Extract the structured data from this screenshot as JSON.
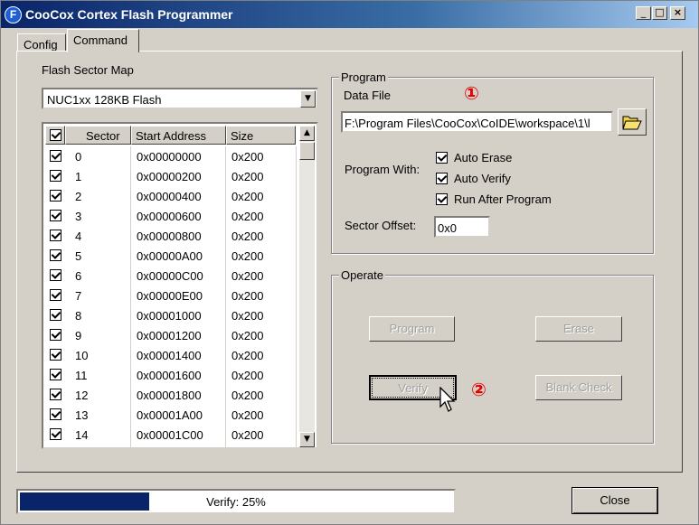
{
  "window": {
    "title": "CooCox Cortex Flash Programmer",
    "app_icon": "F"
  },
  "titlebar_buttons": {
    "minimize": "_",
    "maximize": "□",
    "close": "×"
  },
  "tabs": [
    {
      "label": "Config",
      "active": false
    },
    {
      "label": "Command",
      "active": true
    }
  ],
  "flash_sector_map": {
    "label": "Flash Sector Map",
    "selected": "NUC1xx 128KB Flash"
  },
  "sector_table": {
    "columns": [
      "Sector",
      "Start Address",
      "Size"
    ],
    "header_checked": true,
    "rows": [
      {
        "sector": "0",
        "start": "0x00000000",
        "size": "0x200",
        "checked": true
      },
      {
        "sector": "1",
        "start": "0x00000200",
        "size": "0x200",
        "checked": true
      },
      {
        "sector": "2",
        "start": "0x00000400",
        "size": "0x200",
        "checked": true
      },
      {
        "sector": "3",
        "start": "0x00000600",
        "size": "0x200",
        "checked": true
      },
      {
        "sector": "4",
        "start": "0x00000800",
        "size": "0x200",
        "checked": true
      },
      {
        "sector": "5",
        "start": "0x00000A00",
        "size": "0x200",
        "checked": true
      },
      {
        "sector": "6",
        "start": "0x00000C00",
        "size": "0x200",
        "checked": true
      },
      {
        "sector": "7",
        "start": "0x00000E00",
        "size": "0x200",
        "checked": true
      },
      {
        "sector": "8",
        "start": "0x00001000",
        "size": "0x200",
        "checked": true
      },
      {
        "sector": "9",
        "start": "0x00001200",
        "size": "0x200",
        "checked": true
      },
      {
        "sector": "10",
        "start": "0x00001400",
        "size": "0x200",
        "checked": true
      },
      {
        "sector": "11",
        "start": "0x00001600",
        "size": "0x200",
        "checked": true
      },
      {
        "sector": "12",
        "start": "0x00001800",
        "size": "0x200",
        "checked": true
      },
      {
        "sector": "13",
        "start": "0x00001A00",
        "size": "0x200",
        "checked": true
      },
      {
        "sector": "14",
        "start": "0x00001C00",
        "size": "0x200",
        "checked": true
      }
    ]
  },
  "program": {
    "group_label": "Program",
    "data_file_label": "Data File",
    "data_file_value": "F:\\Program Files\\CooCox\\CoIDE\\workspace\\1\\l",
    "program_with_label": "Program With:",
    "options": [
      {
        "label": "Auto Erase",
        "checked": true
      },
      {
        "label": "Auto Verify",
        "checked": true
      },
      {
        "label": "Run After Program",
        "checked": true
      }
    ],
    "sector_offset_label": "Sector Offset:",
    "sector_offset_value": "0x0"
  },
  "operate": {
    "group_label": "Operate",
    "buttons": {
      "program": "Program",
      "erase": "Erase",
      "verify": "Verify",
      "blank_check": "Blank Check"
    }
  },
  "annotations": {
    "marker_1": "①",
    "marker_2": "②",
    "color": "#e00000"
  },
  "progress": {
    "text": "Verify: 25%",
    "value": 0.25,
    "color": "#0a246a"
  },
  "close_label": "Close",
  "icons": {
    "browse": "folder-open-icon",
    "cursor": "mouse-pointer-icon"
  }
}
